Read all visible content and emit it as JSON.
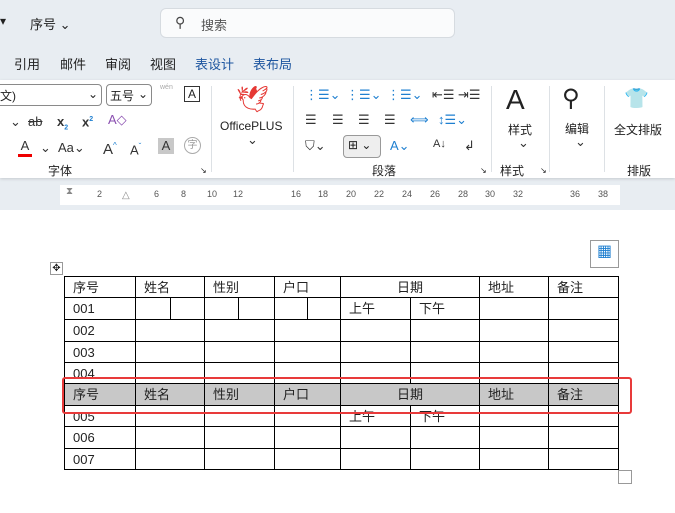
{
  "titlebar": {
    "doc_name": "序号",
    "search_placeholder": "搜索"
  },
  "tabs": [
    "引用",
    "邮件",
    "审阅",
    "视图",
    "表设计",
    "表布局"
  ],
  "ribbon": {
    "font_name": "文)",
    "font_size": "五号",
    "pinyin": "wén",
    "font_group": "字体",
    "officeplus": "OfficePLUS",
    "paragraph_group": "段落",
    "styles_btn": "样式",
    "styles_group": "样式",
    "edit_btn": "编辑",
    "layout_btn": "全文排版",
    "layout_group": "排版"
  },
  "ruler": [
    "2",
    "6",
    "8",
    "10",
    "12",
    "16",
    "18",
    "20",
    "22",
    "24",
    "26",
    "28",
    "30",
    "32",
    "36",
    "38"
  ],
  "table": {
    "headers": [
      "序号",
      "姓名",
      "性别",
      "户口",
      "日期",
      "地址",
      "备注"
    ],
    "sub_headers": [
      "上午",
      "下午"
    ],
    "rows": [
      "001",
      "002",
      "003",
      "004",
      "005",
      "006",
      "007"
    ]
  },
  "colors": {
    "accent": "#1e56a0",
    "highlight_box": "#e83a3a",
    "header_fill": "#c8c8c8"
  }
}
